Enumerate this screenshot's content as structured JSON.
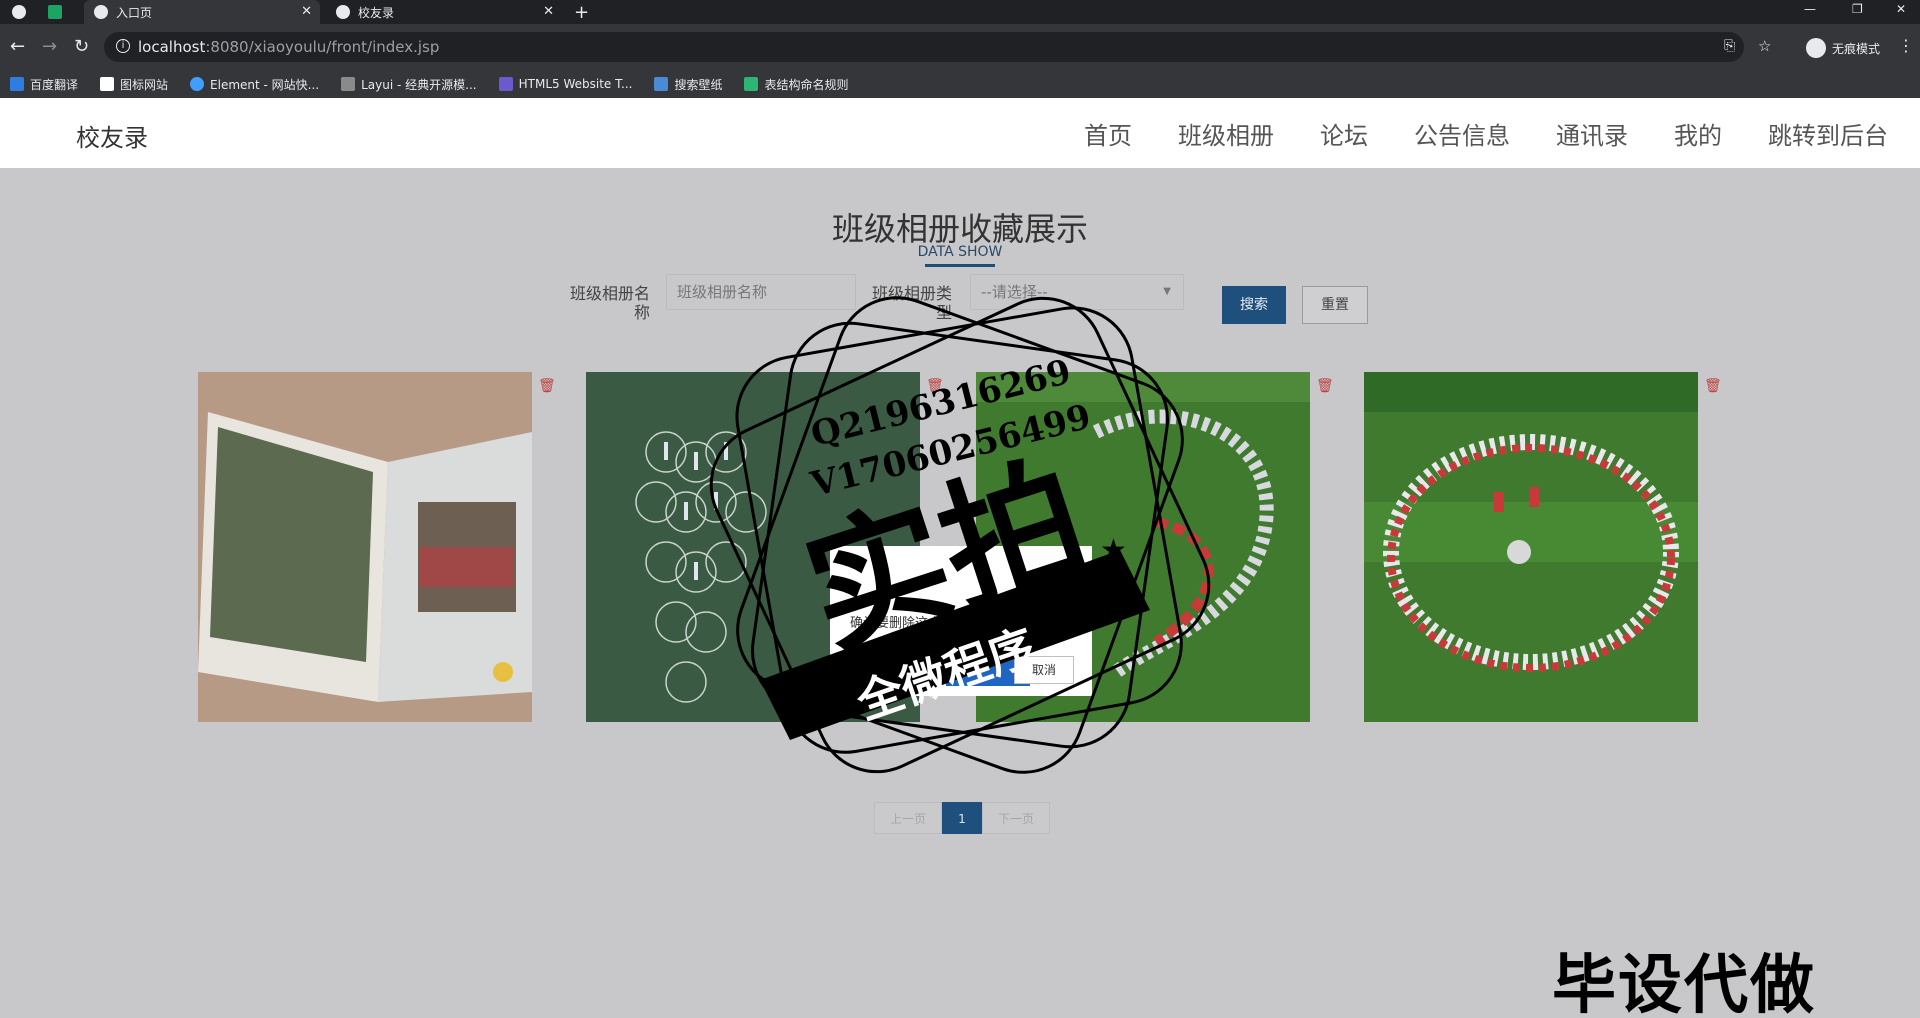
{
  "browser": {
    "tabs": [
      {
        "label": ""
      },
      {
        "label": ""
      },
      {
        "label": "入口页"
      },
      {
        "label": "校友录"
      }
    ],
    "url_host": "localhost",
    "url_rest": ":8080/xiaoyoulu/front/index.jsp",
    "profile_label": "无痕模式",
    "bookmarks": [
      {
        "label": "百度翻译",
        "color": "#2f7de1"
      },
      {
        "label": "图标网站",
        "color": "#ffffff"
      },
      {
        "label": "Element - 网站快...",
        "color": "#409eff"
      },
      {
        "label": "Layui - 经典开源模...",
        "color": "#ffffff"
      },
      {
        "label": "HTML5 Website T...",
        "color": "#6a5acd"
      },
      {
        "label": "搜索壁纸",
        "color": "#4a8bd6"
      },
      {
        "label": "表结构命名规则",
        "color": "#2bb673"
      }
    ]
  },
  "site": {
    "brand": "校友录",
    "nav": [
      "首页",
      "班级相册",
      "论坛",
      "公告信息",
      "通讯录",
      "我的",
      "跳转到后台"
    ]
  },
  "page": {
    "title": "班级相册收藏展示",
    "subtitle": "DATA SHOW",
    "search": {
      "name_label_line1": "班级相册名",
      "name_label_line2": "称",
      "name_placeholder": "班级相册名称",
      "type_label_line1": "班级相册类",
      "type_label_line2": "型",
      "type_value": "--请选择--",
      "search_button": "搜索",
      "reset_button": "重置"
    },
    "pagination": {
      "prev": "上一页",
      "current": "1",
      "next": "下一页"
    }
  },
  "dialog": {
    "message": "确认要删除这个收藏吗？",
    "cancel": "取消"
  },
  "watermark": {
    "line1": "Q2196316269",
    "line2": "V17060256499",
    "big": "实拍",
    "banner": "全微程序",
    "corner": "毕设代做"
  },
  "colors": {
    "primary": "#1f4f7d",
    "trash": "#c04040"
  }
}
